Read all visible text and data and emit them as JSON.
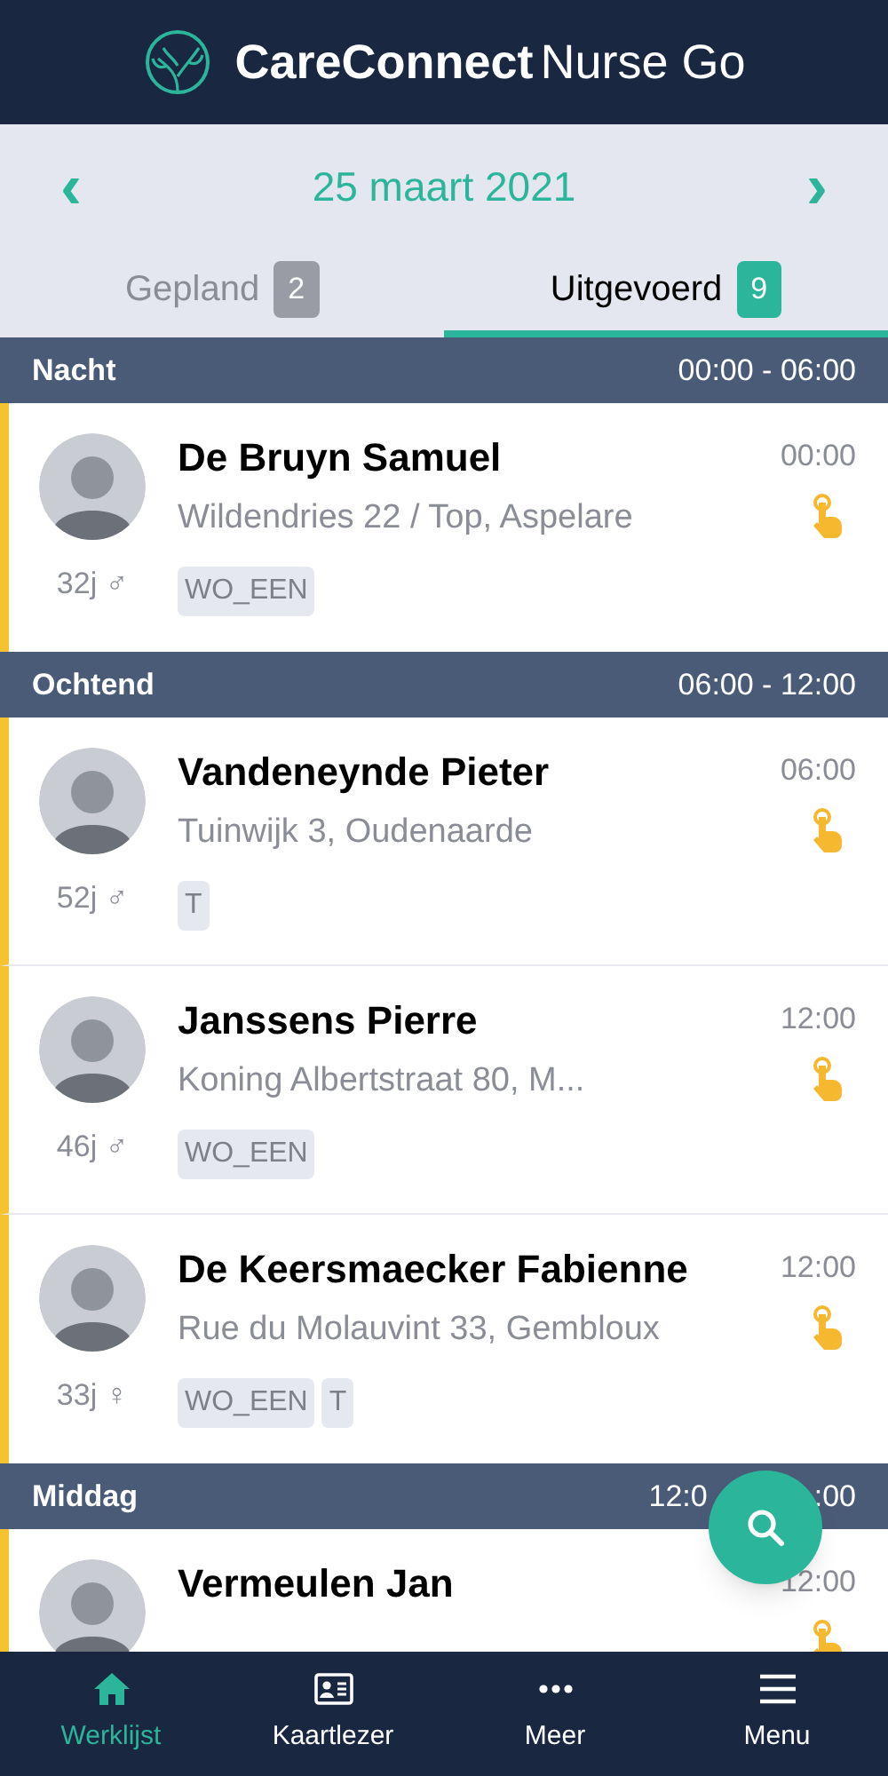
{
  "header": {
    "title_bold": "CareConnect",
    "title_light": "Nurse Go"
  },
  "date_nav": {
    "prev": "‹",
    "date": "25 maart 2021",
    "next": "›"
  },
  "tabs": [
    {
      "label": "Gepland",
      "count": "2",
      "selected": false
    },
    {
      "label": "Uitgevoerd",
      "count": "9",
      "selected": true
    }
  ],
  "sections": [
    {
      "name": "Nacht",
      "time": "00:00 - 06:00",
      "patients": [
        {
          "name": "De Bruyn Samuel",
          "address": "Wildendries 22 / Top, Aspelare",
          "age": "32j ♂",
          "time": "00:00",
          "tags": [
            "WO_EEN"
          ]
        }
      ]
    },
    {
      "name": "Ochtend",
      "time": "06:00 - 12:00",
      "patients": [
        {
          "name": "Vandeneynde Pieter",
          "address": "Tuinwijk 3, Oudenaarde",
          "age": "52j ♂",
          "time": "06:00",
          "tags": [
            "T"
          ]
        },
        {
          "name": "Janssens Pierre",
          "address": "Koning Albertstraat 80, M...",
          "age": "46j ♂",
          "time": "12:00",
          "tags": [
            "WO_EEN"
          ]
        },
        {
          "name": "De Keersmaecker Fabienne",
          "address": "Rue du Molauvint 33, Gembloux",
          "age": "33j ♀",
          "time": "12:00",
          "tags": [
            "WO_EEN",
            "T"
          ]
        }
      ]
    },
    {
      "name": "Middag",
      "time_visible_start": "12:0",
      "time_visible_end": ":00",
      "patients": [
        {
          "name": "Vermeulen Jan",
          "time": "12:00"
        }
      ]
    }
  ],
  "bottom_nav": [
    {
      "label": "Werklijst",
      "selected": true
    },
    {
      "label": "Kaartlezer",
      "selected": false
    },
    {
      "label": "Meer",
      "selected": false
    },
    {
      "label": "Menu",
      "selected": false
    }
  ]
}
